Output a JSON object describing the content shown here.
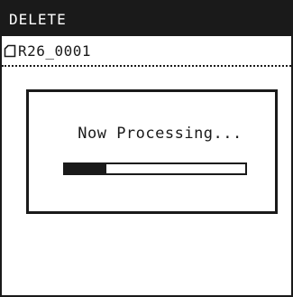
{
  "header": {
    "title": "DELETE"
  },
  "file": {
    "icon": "file-icon",
    "name": "R26_0001"
  },
  "dialog": {
    "message": "Now Processing...",
    "progress": 0.23
  },
  "colors": {
    "foreground": "#1a1a1a",
    "background": "#ffffff"
  }
}
